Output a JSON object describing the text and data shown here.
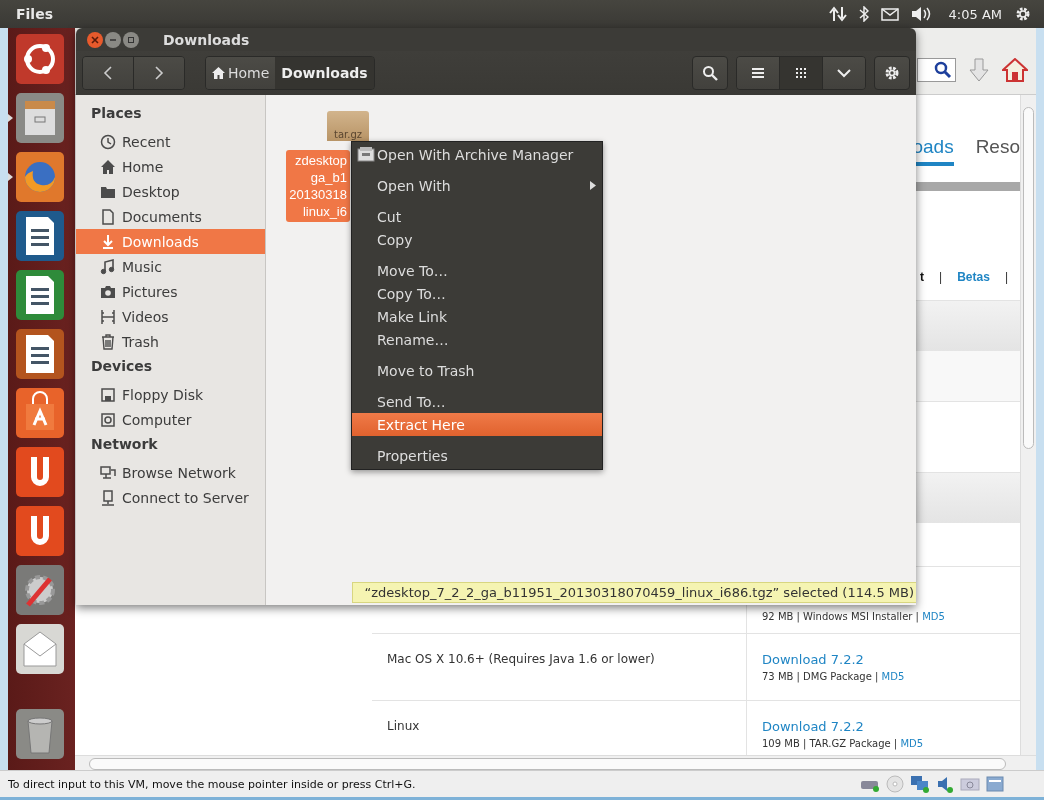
{
  "top_panel": {
    "app_name": "Files",
    "time": "4:05 AM"
  },
  "launcher": [
    {
      "running": false
    },
    {
      "running": true
    },
    {
      "running": true
    },
    {
      "running": false
    },
    {
      "running": false
    },
    {
      "running": false
    },
    {
      "running": false
    },
    {
      "running": false
    },
    {
      "running": false
    },
    {
      "running": false
    },
    {
      "running": false
    },
    {
      "running": false
    }
  ],
  "browser": {
    "tabs": [
      {
        "label": "oads",
        "selected": true
      },
      {
        "label": "Reso",
        "selected": false
      }
    ],
    "links": [
      {
        "label": "t",
        "kind": "text"
      },
      {
        "label": "|",
        "kind": "sep"
      },
      {
        "label": "Betas",
        "kind": "link"
      },
      {
        "label": "|",
        "kind": "sep"
      }
    ],
    "rows": [
      {
        "platform": "",
        "link": "",
        "meta": "92 MB | Windows MSI Installer | ",
        "md5": "MD5"
      },
      {
        "platform": "Mac OS X 10.6+ (Requires Java 1.6 or lower)",
        "link": "Download 7.2.2",
        "meta": "73 MB | DMG Package | ",
        "md5": "MD5"
      },
      {
        "platform": "Linux",
        "link": "Download 7.2.2",
        "meta": "109 MB | TAR.GZ Package | ",
        "md5": "MD5"
      }
    ]
  },
  "file_manager": {
    "title": "Downloads",
    "path": [
      {
        "label": "Home",
        "selected": false
      },
      {
        "label": "Downloads",
        "selected": true
      }
    ],
    "views": [
      {
        "kind": "list",
        "selected": false
      },
      {
        "kind": "grid",
        "selected": true
      },
      {
        "kind": "menu",
        "selected": false
      }
    ],
    "sidebar": [
      {
        "title": "Places",
        "items": [
          {
            "kind": "recent",
            "label": "Recent",
            "selected": false
          },
          {
            "kind": "home",
            "label": "Home",
            "selected": false
          },
          {
            "kind": "folder",
            "label": "Desktop",
            "selected": false
          },
          {
            "kind": "doc",
            "label": "Documents",
            "selected": false
          },
          {
            "kind": "download",
            "label": "Downloads",
            "selected": true
          },
          {
            "kind": "music",
            "label": "Music",
            "selected": false
          },
          {
            "kind": "camera",
            "label": "Pictures",
            "selected": false
          },
          {
            "kind": "film",
            "label": "Videos",
            "selected": false
          },
          {
            "kind": "trash",
            "label": "Trash",
            "selected": false
          }
        ]
      },
      {
        "title": "Devices",
        "items": [
          {
            "kind": "floppy",
            "label": "Floppy Disk",
            "selected": false
          },
          {
            "kind": "computer",
            "label": "Computer",
            "selected": false
          }
        ]
      },
      {
        "title": "Network",
        "items": [
          {
            "kind": "network",
            "label": "Browse Network",
            "selected": false
          },
          {
            "kind": "server",
            "label": "Connect to Server",
            "selected": false
          }
        ]
      }
    ],
    "files": [
      {
        "type_label": "tar.gz",
        "name_lines": [
          "zdesktop",
          "ga_b1",
          "20130318",
          "linux_i6"
        ],
        "selected": true
      }
    ],
    "context_menu": [
      [
        {
          "label": "Open With Archive Manager",
          "kind": "app",
          "selected": false
        }
      ],
      [
        {
          "label": "Open With",
          "kind": "submenu",
          "selected": false
        }
      ],
      [
        {
          "label": "Cut",
          "kind": "plain",
          "selected": false
        },
        {
          "label": "Copy",
          "kind": "plain",
          "selected": false
        }
      ],
      [
        {
          "label": "Move To…",
          "kind": "plain",
          "selected": false
        },
        {
          "label": "Copy To…",
          "kind": "plain",
          "selected": false
        },
        {
          "label": "Make Link",
          "kind": "plain",
          "selected": false
        },
        {
          "label": "Rename…",
          "kind": "plain",
          "selected": false
        }
      ],
      [
        {
          "label": "Move to Trash",
          "kind": "plain",
          "selected": false
        }
      ],
      [
        {
          "label": "Send To…",
          "kind": "plain",
          "selected": false
        },
        {
          "label": "Extract Here",
          "kind": "plain",
          "selected": true
        }
      ],
      [
        {
          "label": "Properties",
          "kind": "plain",
          "selected": false
        }
      ]
    ],
    "status": "“zdesktop_7_2_2_ga_b11951_20130318070459_linux_i686.tgz” selected  (114.5 MB)"
  },
  "vm_status": {
    "message": "To direct input to this VM, move the mouse pointer inside or press Ctrl+G."
  }
}
